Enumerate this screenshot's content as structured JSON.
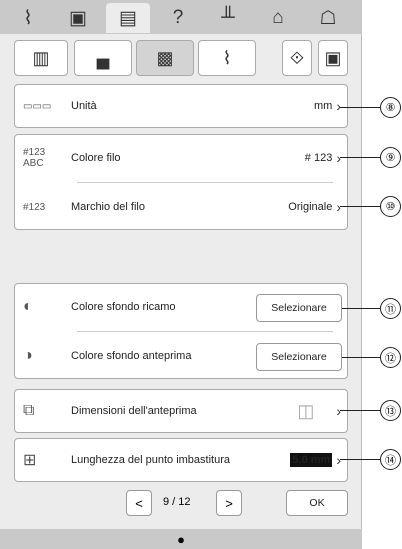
{
  "top_tabs": [
    {
      "icon": "wifi-icon",
      "glyph": "⌇"
    },
    {
      "icon": "camera-icon",
      "glyph": "▣"
    },
    {
      "icon": "document-icon",
      "glyph": "▤"
    },
    {
      "icon": "help-icon",
      "glyph": "?"
    },
    {
      "icon": "bobbin-icon",
      "glyph": "╨"
    },
    {
      "icon": "lock-icon",
      "glyph": "⌂"
    },
    {
      "icon": "house-icon",
      "glyph": "☖"
    }
  ],
  "sub_tabs": [
    {
      "icon": "book-icon",
      "glyph": "▥"
    },
    {
      "icon": "sewing-machine-icon",
      "glyph": "▄"
    },
    {
      "icon": "embroidery-icon",
      "glyph": "▩"
    },
    {
      "icon": "wireless-icon",
      "glyph": "⌇"
    }
  ],
  "rows": {
    "units": {
      "label": "Unità",
      "value": "mm"
    },
    "thread_color": {
      "label": "Colore filo",
      "value": "# 123",
      "icon_text": "#123 ABC"
    },
    "thread_brand": {
      "label": "Marchio del filo",
      "value": "Originale",
      "icon_text": "#123"
    },
    "embroidery_bg": {
      "label": "Colore sfondo ricamo",
      "button": "Selezionare"
    },
    "preview_bg": {
      "label": "Colore sfondo anteprima",
      "button": "Selezionare"
    },
    "preview_size": {
      "label": "Dimensioni dell'anteprima"
    },
    "basting_length": {
      "label": "Lunghezza del punto imbastitura",
      "value": "5.0 mm"
    }
  },
  "callouts": [
    "⑧",
    "⑨",
    "⑩",
    "⑪",
    "⑫",
    "⑬",
    "⑭"
  ],
  "pager": {
    "text": "9 / 12",
    "prev": "<",
    "next": ">",
    "ok": "OK"
  }
}
